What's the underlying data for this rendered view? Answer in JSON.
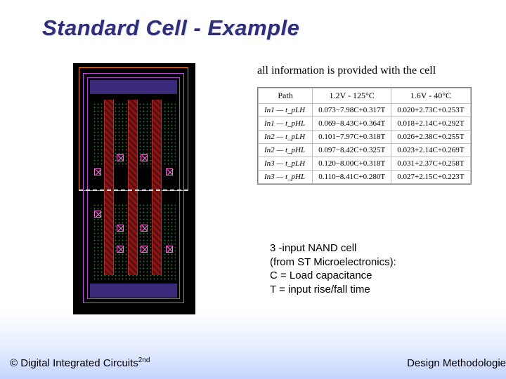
{
  "title": "Standard Cell - Example",
  "caption_top": "all information is provided with the cell",
  "table": {
    "headers": [
      "Path",
      "1.2V - 125°C",
      "1.6V - 40°C"
    ],
    "rows": [
      [
        "In1 — t_pLH",
        "0.073−7.98C+0.317T",
        "0.020+2.73C+0.253T"
      ],
      [
        "In1 — t_pHL",
        "0.069−8.43C+0.364T",
        "0.018+2.14C+0.292T"
      ],
      [
        "In2 — t_pLH",
        "0.101−7.97C+0.318T",
        "0.026+2.38C+0.255T"
      ],
      [
        "In2 — t_pHL",
        "0.097−8.42C+0.325T",
        "0.023+2.14C+0.269T"
      ],
      [
        "In3 — t_pLH",
        "0.120−8.00C+0.318T",
        "0.031+2.37C+0.258T"
      ],
      [
        "In3 — t_pHL",
        "0.110−8.41C+0.280T",
        "0.027+2.15C+0.223T"
      ]
    ]
  },
  "desc": {
    "l1": "3 -input NAND cell",
    "l2": "(from ST Microelectronics):",
    "l3": "C = Load capacitance",
    "l4": "T = input rise/fall time"
  },
  "footer": {
    "left_pre": "© Digital Integrated Circuits",
    "left_sup": "2nd",
    "right": "Design Methodologie"
  }
}
